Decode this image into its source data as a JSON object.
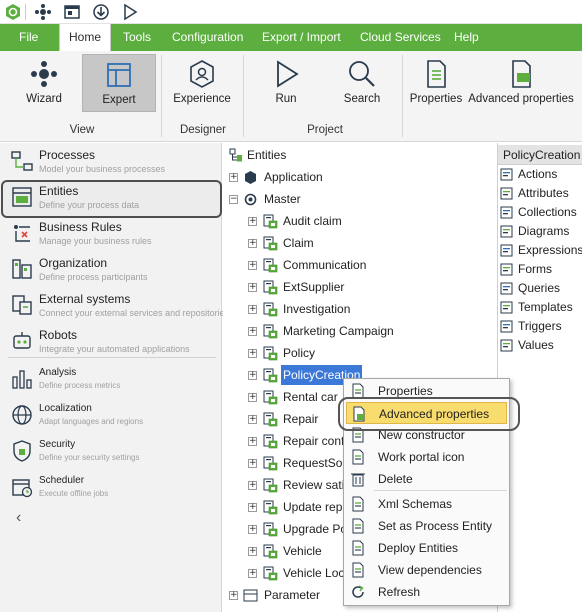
{
  "quick_access": {
    "icons": [
      "app-logo-icon",
      "process-icon",
      "window-icon",
      "download-icon",
      "run-icon"
    ]
  },
  "menu": {
    "tabs": [
      "File",
      "Home",
      "Tools",
      "Configuration",
      "Export / Import",
      "Cloud Services",
      "Help"
    ],
    "active": "Home"
  },
  "ribbon": {
    "buttons": {
      "wizard": "Wizard",
      "expert": "Expert",
      "experience": "Experience",
      "run": "Run",
      "search": "Search",
      "properties": "Properties",
      "advanced_properties": "Advanced properties"
    },
    "groups": {
      "view": "View",
      "designer": "Designer",
      "project": "Project"
    },
    "selected": "Expert"
  },
  "nav": [
    {
      "title": "Processes",
      "subtitle": "Model your business processes"
    },
    {
      "title": "Entities",
      "subtitle": "Define your process data"
    },
    {
      "title": "Business Rules",
      "subtitle": "Manage your business rules"
    },
    {
      "title": "Organization",
      "subtitle": "Define process participants"
    },
    {
      "title": "External systems",
      "subtitle": "Connect your external services and repositories"
    },
    {
      "title": "Robots",
      "subtitle": "Integrate your automated applications"
    },
    {
      "title": "Analysis",
      "subtitle": "Define process metrics"
    },
    {
      "title": "Localization",
      "subtitle": "Adapt languages and regions"
    },
    {
      "title": "Security",
      "subtitle": "Define your security settings"
    },
    {
      "title": "Scheduler",
      "subtitle": "Execute offline jobs"
    }
  ],
  "nav_collapse": "‹",
  "tree": {
    "root": "Entities",
    "application": "Application",
    "master": "Master",
    "master_children": [
      "Audit claim",
      "Claim",
      "Communication",
      "ExtSupplier",
      "Investigation",
      "Marketing Campaign",
      "Policy",
      "PolicyCreation",
      "Rental car",
      "Repair",
      "Repair confi",
      "RequestSoli",
      "Review satis",
      "Update repa",
      "Upgrade Po",
      "Vehicle",
      "Vehicle Loca"
    ],
    "selected": "PolicyCreation",
    "parameter": "Parameter",
    "expand_glyph": "+",
    "collapse_glyph": "−"
  },
  "right_panel": {
    "header": "PolicyCreation",
    "items": [
      "Actions",
      "Attributes",
      "Collections",
      "Diagrams",
      "Expressions",
      "Forms",
      "Queries",
      "Templates",
      "Triggers",
      "Values"
    ]
  },
  "context_menu": {
    "items": [
      "Properties",
      "Advanced properties",
      "New constructor",
      "Work portal icon",
      "Delete",
      "Xml Schemas",
      "Set as Process Entity",
      "Deploy Entities",
      "View dependencies",
      "Refresh"
    ],
    "highlighted": "Advanced properties"
  },
  "colors": {
    "menubar": "#5cae3f",
    "selection": "#3b78d8",
    "menu_highlight": "#f9dc6e",
    "accent_green": "#5cae3f",
    "icon_blue": "#2f6fb5"
  }
}
